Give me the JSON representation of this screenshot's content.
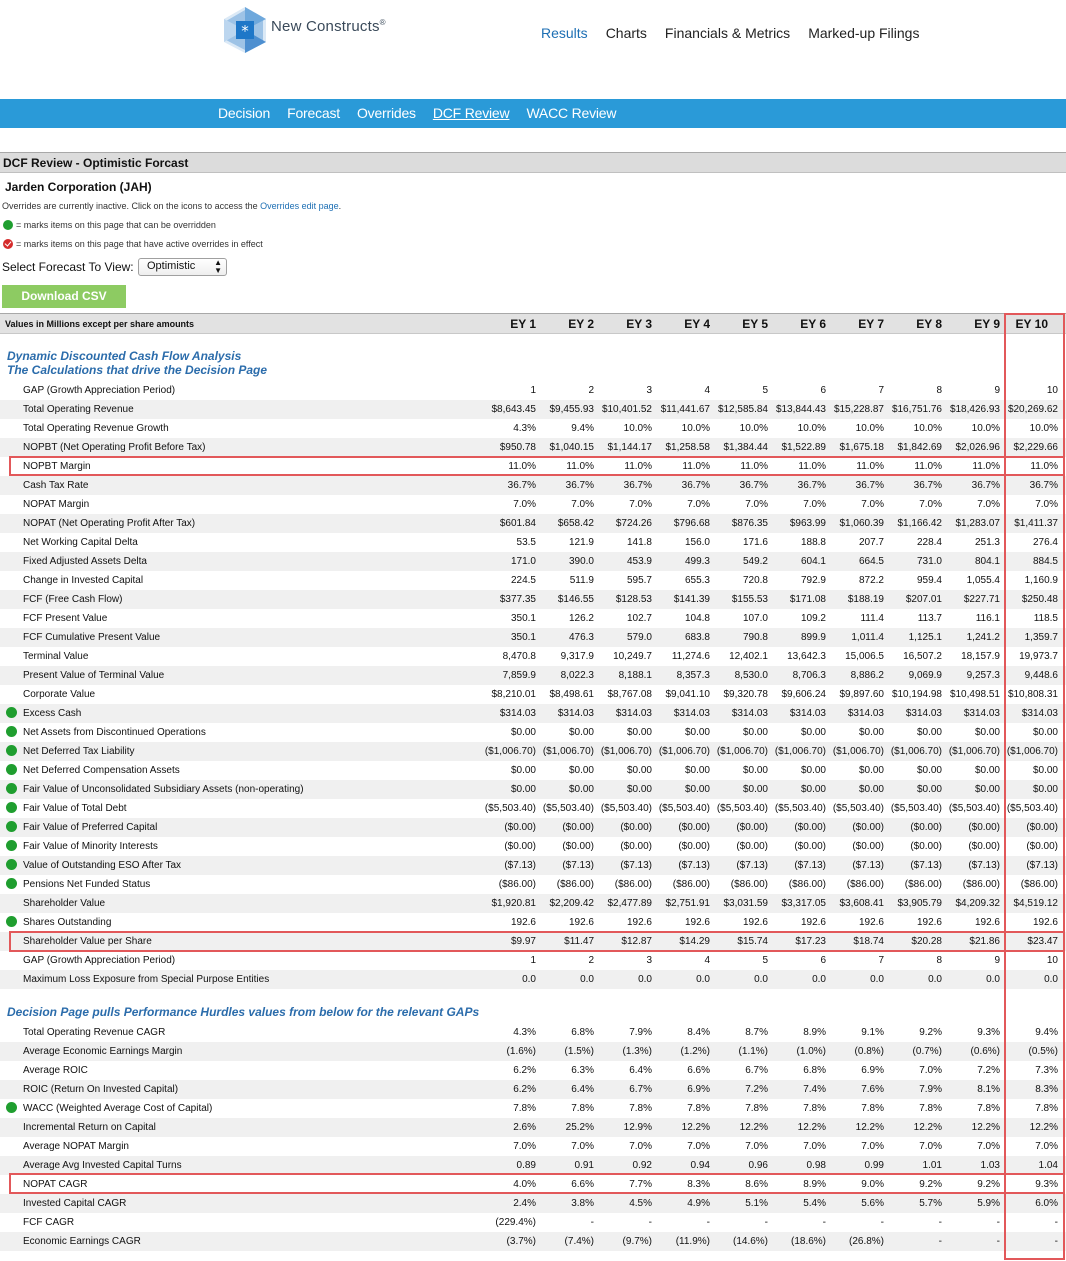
{
  "header": {
    "brand": "New Constructs",
    "brand_mark": "®",
    "nav": [
      "Results",
      "Charts",
      "Financials & Metrics",
      "Marked-up Filings"
    ],
    "active_nav": "Results"
  },
  "subnav": {
    "items": [
      "Decision",
      "Forecast",
      "Overrides",
      "DCF Review",
      "WACC Review"
    ],
    "active": "DCF Review"
  },
  "section_title": "DCF Review - Optimistic Forcast",
  "company": "Jarden Corporation (JAH)",
  "note_text": "Overrides are currently inactive. Click on the icons to access the ",
  "note_link": "Overrides edit page",
  "note_end": ".",
  "legend_green": "= marks items on this page that can be overridden",
  "legend_red": "= marks items on this page that have active overrides in effect",
  "forecast_label": "Select Forecast To View:",
  "forecast_value": "Optimistic",
  "download_label": "Download CSV",
  "table": {
    "units_label": "Values in Millions except per share amounts",
    "columns": [
      "EY 1",
      "EY 2",
      "EY 3",
      "EY 4",
      "EY 5",
      "EY 6",
      "EY 7",
      "EY 8",
      "EY 9",
      "EY 10"
    ],
    "section1_line1": "Dynamic Discounted Cash Flow Analysis",
    "section1_line2": "The Calculations that drive the Decision Page",
    "section2_title": "Decision Page pulls Performance Hurdles values from below for the relevant GAPs",
    "rows1": [
      {
        "label": "GAP (Growth Appreciation Period)",
        "dot": false,
        "values": [
          "1",
          "2",
          "3",
          "4",
          "5",
          "6",
          "7",
          "8",
          "9",
          "10"
        ]
      },
      {
        "label": "Total Operating Revenue",
        "dot": false,
        "values": [
          "$8,643.45",
          "$9,455.93",
          "$10,401.52",
          "$11,441.67",
          "$12,585.84",
          "$13,844.43",
          "$15,228.87",
          "$16,751.76",
          "$18,426.93",
          "$20,269.62"
        ]
      },
      {
        "label": "Total Operating Revenue Growth",
        "dot": false,
        "values": [
          "4.3%",
          "9.4%",
          "10.0%",
          "10.0%",
          "10.0%",
          "10.0%",
          "10.0%",
          "10.0%",
          "10.0%",
          "10.0%"
        ]
      },
      {
        "label": "NOPBT (Net Operating Profit Before Tax)",
        "dot": false,
        "values": [
          "$950.78",
          "$1,040.15",
          "$1,144.17",
          "$1,258.58",
          "$1,384.44",
          "$1,522.89",
          "$1,675.18",
          "$1,842.69",
          "$2,026.96",
          "$2,229.66"
        ]
      },
      {
        "label": "NOPBT Margin",
        "dot": false,
        "values": [
          "11.0%",
          "11.0%",
          "11.0%",
          "11.0%",
          "11.0%",
          "11.0%",
          "11.0%",
          "11.0%",
          "11.0%",
          "11.0%"
        ]
      },
      {
        "label": "Cash Tax Rate",
        "dot": false,
        "values": [
          "36.7%",
          "36.7%",
          "36.7%",
          "36.7%",
          "36.7%",
          "36.7%",
          "36.7%",
          "36.7%",
          "36.7%",
          "36.7%"
        ]
      },
      {
        "label": "NOPAT Margin",
        "dot": false,
        "values": [
          "7.0%",
          "7.0%",
          "7.0%",
          "7.0%",
          "7.0%",
          "7.0%",
          "7.0%",
          "7.0%",
          "7.0%",
          "7.0%"
        ]
      },
      {
        "label": "NOPAT (Net Operating Profit After Tax)",
        "dot": false,
        "values": [
          "$601.84",
          "$658.42",
          "$724.26",
          "$796.68",
          "$876.35",
          "$963.99",
          "$1,060.39",
          "$1,166.42",
          "$1,283.07",
          "$1,411.37"
        ]
      },
      {
        "label": "Net Working Capital Delta",
        "dot": false,
        "values": [
          "53.5",
          "121.9",
          "141.8",
          "156.0",
          "171.6",
          "188.8",
          "207.7",
          "228.4",
          "251.3",
          "276.4"
        ]
      },
      {
        "label": "Fixed Adjusted Assets Delta",
        "dot": false,
        "values": [
          "171.0",
          "390.0",
          "453.9",
          "499.3",
          "549.2",
          "604.1",
          "664.5",
          "731.0",
          "804.1",
          "884.5"
        ]
      },
      {
        "label": "Change in Invested Capital",
        "dot": false,
        "values": [
          "224.5",
          "511.9",
          "595.7",
          "655.3",
          "720.8",
          "792.9",
          "872.2",
          "959.4",
          "1,055.4",
          "1,160.9"
        ]
      },
      {
        "label": "FCF (Free Cash Flow)",
        "dot": false,
        "values": [
          "$377.35",
          "$146.55",
          "$128.53",
          "$141.39",
          "$155.53",
          "$171.08",
          "$188.19",
          "$207.01",
          "$227.71",
          "$250.48"
        ]
      },
      {
        "label": "FCF Present Value",
        "dot": false,
        "values": [
          "350.1",
          "126.2",
          "102.7",
          "104.8",
          "107.0",
          "109.2",
          "111.4",
          "113.7",
          "116.1",
          "118.5"
        ]
      },
      {
        "label": "FCF Cumulative Present Value",
        "dot": false,
        "values": [
          "350.1",
          "476.3",
          "579.0",
          "683.8",
          "790.8",
          "899.9",
          "1,011.4",
          "1,125.1",
          "1,241.2",
          "1,359.7"
        ]
      },
      {
        "label": "Terminal Value",
        "dot": false,
        "values": [
          "8,470.8",
          "9,317.9",
          "10,249.7",
          "11,274.6",
          "12,402.1",
          "13,642.3",
          "15,006.5",
          "16,507.2",
          "18,157.9",
          "19,973.7"
        ]
      },
      {
        "label": "Present Value of Terminal Value",
        "dot": false,
        "values": [
          "7,859.9",
          "8,022.3",
          "8,188.1",
          "8,357.3",
          "8,530.0",
          "8,706.3",
          "8,886.2",
          "9,069.9",
          "9,257.3",
          "9,448.6"
        ]
      },
      {
        "label": "Corporate Value",
        "dot": false,
        "values": [
          "$8,210.01",
          "$8,498.61",
          "$8,767.08",
          "$9,041.10",
          "$9,320.78",
          "$9,606.24",
          "$9,897.60",
          "$10,194.98",
          "$10,498.51",
          "$10,808.31"
        ]
      },
      {
        "label": "Excess Cash",
        "dot": true,
        "values": [
          "$314.03",
          "$314.03",
          "$314.03",
          "$314.03",
          "$314.03",
          "$314.03",
          "$314.03",
          "$314.03",
          "$314.03",
          "$314.03"
        ]
      },
      {
        "label": "Net Assets from Discontinued Operations",
        "dot": true,
        "values": [
          "$0.00",
          "$0.00",
          "$0.00",
          "$0.00",
          "$0.00",
          "$0.00",
          "$0.00",
          "$0.00",
          "$0.00",
          "$0.00"
        ]
      },
      {
        "label": "Net Deferred Tax Liability",
        "dot": true,
        "values": [
          "($1,006.70)",
          "($1,006.70)",
          "($1,006.70)",
          "($1,006.70)",
          "($1,006.70)",
          "($1,006.70)",
          "($1,006.70)",
          "($1,006.70)",
          "($1,006.70)",
          "($1,006.70)"
        ]
      },
      {
        "label": "Net Deferred Compensation Assets",
        "dot": true,
        "values": [
          "$0.00",
          "$0.00",
          "$0.00",
          "$0.00",
          "$0.00",
          "$0.00",
          "$0.00",
          "$0.00",
          "$0.00",
          "$0.00"
        ]
      },
      {
        "label": "Fair Value of Unconsolidated Subsidiary Assets (non-operating)",
        "dot": true,
        "values": [
          "$0.00",
          "$0.00",
          "$0.00",
          "$0.00",
          "$0.00",
          "$0.00",
          "$0.00",
          "$0.00",
          "$0.00",
          "$0.00"
        ]
      },
      {
        "label": "Fair Value of Total Debt",
        "dot": true,
        "values": [
          "($5,503.40)",
          "($5,503.40)",
          "($5,503.40)",
          "($5,503.40)",
          "($5,503.40)",
          "($5,503.40)",
          "($5,503.40)",
          "($5,503.40)",
          "($5,503.40)",
          "($5,503.40)"
        ]
      },
      {
        "label": "Fair Value of Preferred Capital",
        "dot": true,
        "values": [
          "($0.00)",
          "($0.00)",
          "($0.00)",
          "($0.00)",
          "($0.00)",
          "($0.00)",
          "($0.00)",
          "($0.00)",
          "($0.00)",
          "($0.00)"
        ]
      },
      {
        "label": "Fair Value of Minority Interests",
        "dot": true,
        "values": [
          "($0.00)",
          "($0.00)",
          "($0.00)",
          "($0.00)",
          "($0.00)",
          "($0.00)",
          "($0.00)",
          "($0.00)",
          "($0.00)",
          "($0.00)"
        ]
      },
      {
        "label": "Value of Outstanding ESO After Tax",
        "dot": true,
        "values": [
          "($7.13)",
          "($7.13)",
          "($7.13)",
          "($7.13)",
          "($7.13)",
          "($7.13)",
          "($7.13)",
          "($7.13)",
          "($7.13)",
          "($7.13)"
        ]
      },
      {
        "label": "Pensions Net Funded Status",
        "dot": true,
        "values": [
          "($86.00)",
          "($86.00)",
          "($86.00)",
          "($86.00)",
          "($86.00)",
          "($86.00)",
          "($86.00)",
          "($86.00)",
          "($86.00)",
          "($86.00)"
        ]
      },
      {
        "label": "Shareholder Value",
        "dot": false,
        "values": [
          "$1,920.81",
          "$2,209.42",
          "$2,477.89",
          "$2,751.91",
          "$3,031.59",
          "$3,317.05",
          "$3,608.41",
          "$3,905.79",
          "$4,209.32",
          "$4,519.12"
        ]
      },
      {
        "label": "Shares Outstanding",
        "dot": true,
        "values": [
          "192.6",
          "192.6",
          "192.6",
          "192.6",
          "192.6",
          "192.6",
          "192.6",
          "192.6",
          "192.6",
          "192.6"
        ]
      },
      {
        "label": "Shareholder Value per Share",
        "dot": false,
        "values": [
          "$9.97",
          "$11.47",
          "$12.87",
          "$14.29",
          "$15.74",
          "$17.23",
          "$18.74",
          "$20.28",
          "$21.86",
          "$23.47"
        ]
      },
      {
        "label": "GAP (Growth Appreciation Period)",
        "dot": false,
        "values": [
          "1",
          "2",
          "3",
          "4",
          "5",
          "6",
          "7",
          "8",
          "9",
          "10"
        ]
      },
      {
        "label": "Maximum Loss Exposure from Special Purpose Entities",
        "dot": false,
        "values": [
          "0.0",
          "0.0",
          "0.0",
          "0.0",
          "0.0",
          "0.0",
          "0.0",
          "0.0",
          "0.0",
          "0.0"
        ]
      }
    ],
    "rows2": [
      {
        "label": "Total Operating Revenue CAGR",
        "dot": false,
        "values": [
          "4.3%",
          "6.8%",
          "7.9%",
          "8.4%",
          "8.7%",
          "8.9%",
          "9.1%",
          "9.2%",
          "9.3%",
          "9.4%"
        ]
      },
      {
        "label": "Average Economic Earnings Margin",
        "dot": false,
        "values": [
          "(1.6%)",
          "(1.5%)",
          "(1.3%)",
          "(1.2%)",
          "(1.1%)",
          "(1.0%)",
          "(0.8%)",
          "(0.7%)",
          "(0.6%)",
          "(0.5%)"
        ]
      },
      {
        "label": "Average ROIC",
        "dot": false,
        "values": [
          "6.2%",
          "6.3%",
          "6.4%",
          "6.6%",
          "6.7%",
          "6.8%",
          "6.9%",
          "7.0%",
          "7.2%",
          "7.3%"
        ]
      },
      {
        "label": "ROIC (Return On Invested Capital)",
        "dot": false,
        "values": [
          "6.2%",
          "6.4%",
          "6.7%",
          "6.9%",
          "7.2%",
          "7.4%",
          "7.6%",
          "7.9%",
          "8.1%",
          "8.3%"
        ]
      },
      {
        "label": "WACC (Weighted Average Cost of Capital)",
        "dot": true,
        "values": [
          "7.8%",
          "7.8%",
          "7.8%",
          "7.8%",
          "7.8%",
          "7.8%",
          "7.8%",
          "7.8%",
          "7.8%",
          "7.8%"
        ]
      },
      {
        "label": "Incremental Return on Capital",
        "dot": false,
        "values": [
          "2.6%",
          "25.2%",
          "12.9%",
          "12.2%",
          "12.2%",
          "12.2%",
          "12.2%",
          "12.2%",
          "12.2%",
          "12.2%"
        ]
      },
      {
        "label": "Average NOPAT Margin",
        "dot": false,
        "values": [
          "7.0%",
          "7.0%",
          "7.0%",
          "7.0%",
          "7.0%",
          "7.0%",
          "7.0%",
          "7.0%",
          "7.0%",
          "7.0%"
        ]
      },
      {
        "label": "Average Avg Invested Capital Turns",
        "dot": false,
        "values": [
          "0.89",
          "0.91",
          "0.92",
          "0.94",
          "0.96",
          "0.98",
          "0.99",
          "1.01",
          "1.03",
          "1.04"
        ]
      },
      {
        "label": "NOPAT CAGR",
        "dot": false,
        "values": [
          "4.0%",
          "6.6%",
          "7.7%",
          "8.3%",
          "8.6%",
          "8.9%",
          "9.0%",
          "9.2%",
          "9.2%",
          "9.3%"
        ]
      },
      {
        "label": "Invested Capital CAGR",
        "dot": false,
        "values": [
          "2.4%",
          "3.8%",
          "4.5%",
          "4.9%",
          "5.1%",
          "5.4%",
          "5.6%",
          "5.7%",
          "5.9%",
          "6.0%"
        ]
      },
      {
        "label": "FCF CAGR",
        "dot": false,
        "values": [
          "(229.4%)",
          "-",
          "-",
          "-",
          "-",
          "-",
          "-",
          "-",
          "-",
          "-"
        ]
      },
      {
        "label": "Economic Earnings CAGR",
        "dot": false,
        "values": [
          "(3.7%)",
          "(7.4%)",
          "(9.7%)",
          "(11.9%)",
          "(14.6%)",
          "(18.6%)",
          "(26.8%)",
          "-",
          "-",
          "-"
        ]
      }
    ]
  },
  "colors": {
    "subnav_bg": "#2a9ad8",
    "link_blue": "#1d6fb4",
    "section_title_blue": "#2b6cab",
    "override_green": "#1f9e2f",
    "override_red": "#d52b2b",
    "highlight_red": "#e2585a",
    "csv_green": "#8dcb62"
  },
  "icons": {
    "logo": "hexagon-asterisk-logo",
    "override_available": "green-dot-icon",
    "override_active": "red-check-icon",
    "select_arrow": "updown-chevron-icon"
  }
}
